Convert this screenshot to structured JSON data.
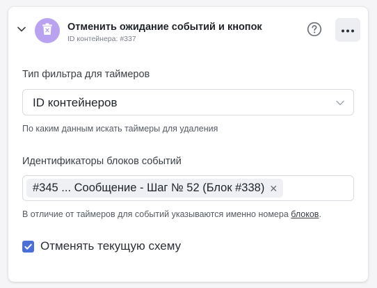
{
  "block": {
    "title": "Отменить ожидание событий и кнопок",
    "subtitle": "ID контейнера: #337",
    "icon": "trash-icon",
    "icon_bg": "#b9a2f0"
  },
  "filter": {
    "label": "Тип фильтра для таймеров",
    "value": "ID контейнеров",
    "hint": "По каким данным искать таймеры для удаления"
  },
  "ids": {
    "label": "Идентификаторы блоков событий",
    "tags": [
      "#345 ... Сообщение - Шаг № 52 (Блок #338)"
    ],
    "hint_before": "В отличие от таймеров для событий указываются именно номера ",
    "hint_link": "блоков",
    "hint_after": "."
  },
  "cancel_current": {
    "label": "Отменять текущую схему",
    "checked": true,
    "color": "#4b6fd8"
  },
  "colors": {
    "more_button_bg": "#eceef1"
  }
}
